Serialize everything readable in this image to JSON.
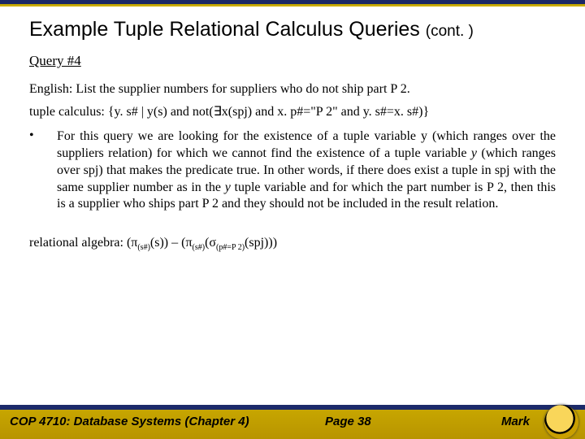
{
  "title_main": "Example Tuple Relational Calculus Queries ",
  "title_cont": "(cont. )",
  "query_label": "Query #4",
  "english_label": "English:  List the supplier numbers for suppliers who do not ship part P 2.",
  "tc_prefix": "tuple calculus: {y. s# | y(s) and not(",
  "tc_exists": "∃",
  "tc_suffix": "x(spj) and x. p#=\"P 2\" and y. s#=x. s#)}",
  "bullet_text": "For this query we are looking for the existence of a tuple variable y (which ranges over the suppliers relation) for which we cannot find the existence of a tuple variable ",
  "bullet_y": "y",
  "bullet_text2": " (which ranges over spj) that makes the predicate true.  In other words, if there does exist a tuple in spj with the same supplier number as in the ",
  "bullet_y2": "y",
  "bullet_text3": " tuple variable and for which the part number is P 2, then this is a supplier who ships part P 2 and they should not be included in the result relation.",
  "ra_prefix": "relational algebra:  (",
  "ra_pi": "π",
  "ra_sub1": "(s#)",
  "ra_mid1": "(s)) – (",
  "ra_pi2": "π",
  "ra_sub2": "(s#)",
  "ra_open": "(",
  "ra_sigma": "σ",
  "ra_sub3": "(p#=P 2)",
  "ra_end": "(spj)))",
  "footer_course": "COP 4710: Database Systems  (Chapter 4)",
  "footer_page": "Page 38",
  "footer_author": "Mark"
}
